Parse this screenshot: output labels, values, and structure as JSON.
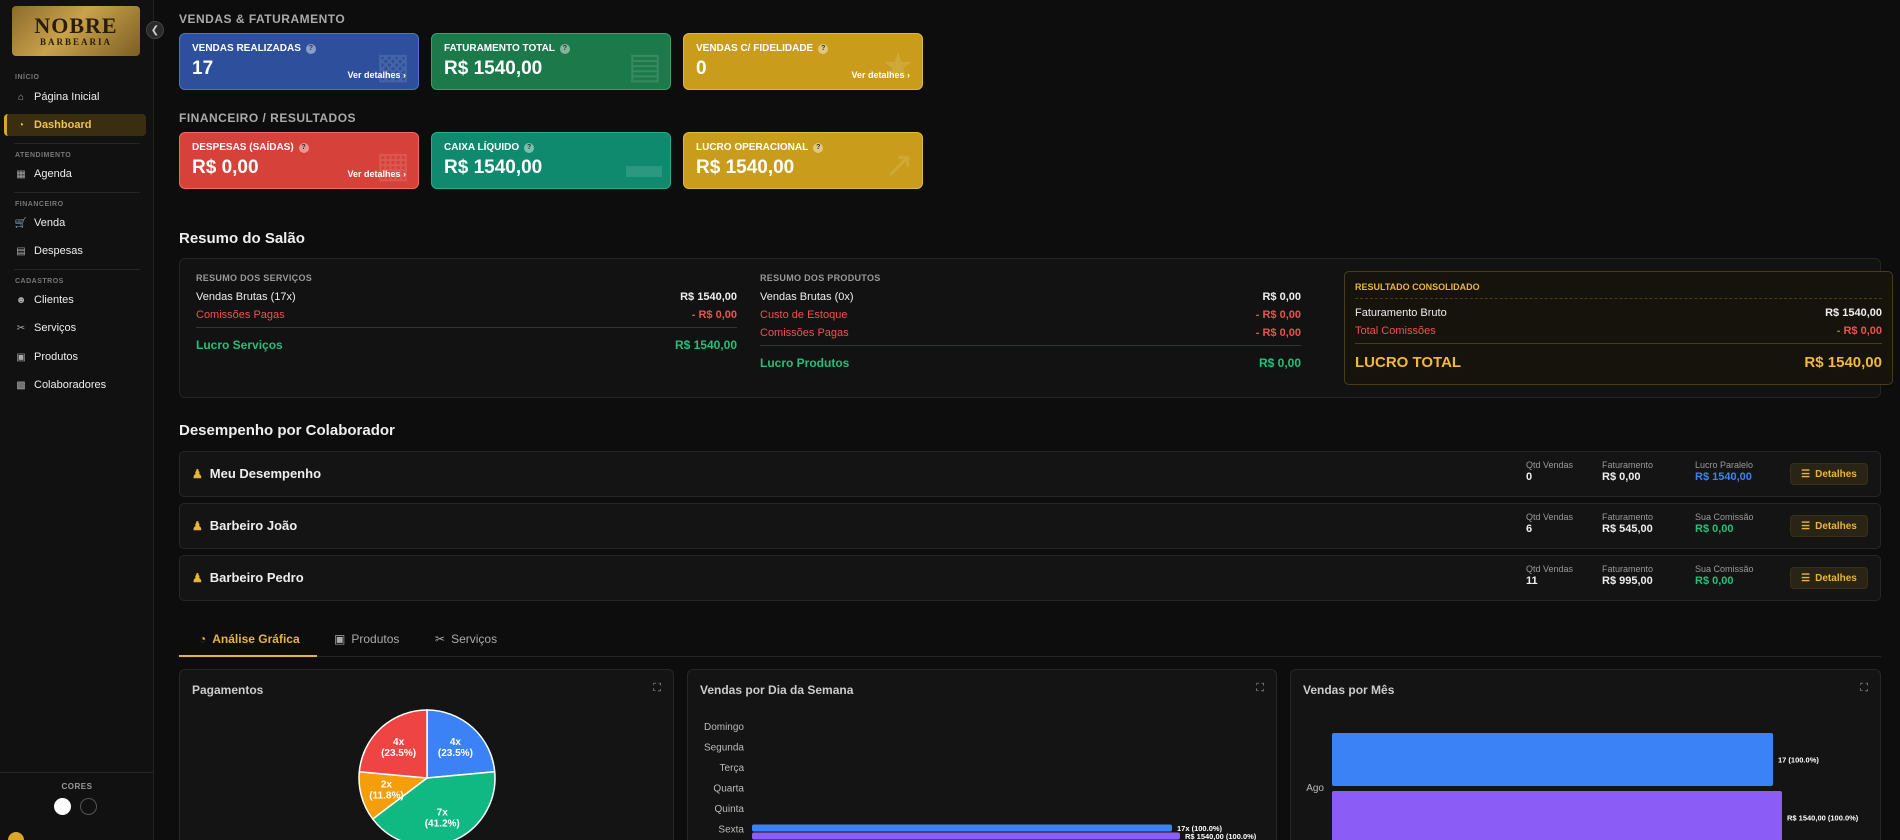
{
  "sidebar": {
    "logo": {
      "line1": "NOBRE",
      "line2": "BARBEARIA"
    },
    "sections": [
      "INÍCIO",
      "ATENDIMENTO",
      "FINANCEIRO",
      "CADASTROS"
    ],
    "items": {
      "home": "Página Inicial",
      "dashboard": "Dashboard",
      "agenda": "Agenda",
      "venda": "Venda",
      "despesas": "Despesas",
      "clientes": "Clientes",
      "servicos": "Serviços",
      "produtos": "Produtos",
      "colaboradores": "Colaboradores"
    },
    "cores_label": "CORES",
    "accent": "#d9a629"
  },
  "vendas": {
    "title": "VENDAS & FATURAMENTO",
    "cards": [
      {
        "label": "VENDAS REALIZADAS",
        "value": "17",
        "more": "Ver detalhes",
        "color": "#2d4f9c"
      },
      {
        "label": "FATURAMENTO TOTAL",
        "value": "R$ 1540,00",
        "color": "#1c7a4a"
      },
      {
        "label": "VENDAS C/ FIDELIDADE",
        "value": "0",
        "more": "Ver detalhes",
        "color": "#c99c1c"
      }
    ]
  },
  "financeiro": {
    "title": "FINANCEIRO / RESULTADOS",
    "cards": [
      {
        "label": "DESPESAS (SAÍDAS)",
        "value": "R$ 0,00",
        "more": "Ver detalhes",
        "color": "#d6413a"
      },
      {
        "label": "CAIXA LÍQUIDO",
        "value": "R$ 1540,00",
        "color": "#0f8a6e"
      },
      {
        "label": "LUCRO OPERACIONAL",
        "value": "R$ 1540,00",
        "color": "#c99c1c"
      }
    ]
  },
  "resumo": {
    "title": "Resumo do Salão",
    "servicos": {
      "head": "RESUMO DOS SERVIÇOS",
      "brutas_label": "Vendas Brutas (17x)",
      "brutas_value": "R$ 1540,00",
      "comissoes_label": "Comissões Pagas",
      "comissoes_value": "- R$ 0,00",
      "lucro_label": "Lucro Serviços",
      "lucro_value": "R$ 1540,00"
    },
    "produtos": {
      "head": "RESUMO DOS PRODUTOS",
      "brutas_label": "Vendas Brutas (0x)",
      "brutas_value": "R$ 0,00",
      "custo_label": "Custo de Estoque",
      "custo_value": "- R$ 0,00",
      "comissoes_label": "Comissões Pagas",
      "comissoes_value": "- R$ 0,00",
      "lucro_label": "Lucro Produtos",
      "lucro_value": "R$ 0,00"
    },
    "consolidado": {
      "head": "RESULTADO CONSOLIDADO",
      "bruto_label": "Faturamento Bruto",
      "bruto_value": "R$ 1540,00",
      "comissoes_label": "Total Comissões",
      "comissoes_value": "- R$ 0,00",
      "total_label": "LUCRO TOTAL",
      "total_value": "R$ 1540,00"
    }
  },
  "desempenho": {
    "title": "Desempenho por Colaborador",
    "details_label": "Detalhes",
    "rows": [
      {
        "name": "Meu Desempenho",
        "qtd_label": "Qtd Vendas",
        "qtd": "0",
        "fat_label": "Faturamento",
        "fat": "R$ 0,00",
        "extra_label": "Lucro Paralelo",
        "extra": "R$ 1540,00"
      },
      {
        "name": "Barbeiro João",
        "qtd_label": "Qtd Vendas",
        "qtd": "6",
        "fat_label": "Faturamento",
        "fat": "R$ 545,00",
        "extra_label": "Sua Comissão",
        "extra": "R$ 0,00"
      },
      {
        "name": "Barbeiro Pedro",
        "qtd_label": "Qtd Vendas",
        "qtd": "11",
        "fat_label": "Faturamento",
        "fat": "R$ 995,00",
        "extra_label": "Sua Comissão",
        "extra": "R$ 0,00"
      }
    ]
  },
  "tabs": [
    "Análise Gráfica",
    "Produtos",
    "Serviços"
  ],
  "chart_data": [
    {
      "type": "pie",
      "title": "Pagamentos",
      "slices": [
        {
          "label": "4x\n(23.5%)",
          "value": 4,
          "percent": 23.5,
          "color": "#3b82f6"
        },
        {
          "label": "7x\n(41.2%)",
          "value": 7,
          "percent": 41.2,
          "color": "#10b981"
        },
        {
          "label": "2x\n(11.8%)",
          "value": 2,
          "percent": 11.8,
          "color": "#f59e0b"
        },
        {
          "label": "4x\n(23.5%)",
          "value": 4,
          "percent": 23.5,
          "color": "#ef4444"
        }
      ]
    },
    {
      "type": "bar",
      "title": "Vendas por Dia da Semana",
      "orientation": "horizontal",
      "categories": [
        "Domingo",
        "Segunda",
        "Terça",
        "Quarta",
        "Quinta",
        "Sexta"
      ],
      "series": [
        {
          "values": [
            0,
            0,
            0,
            0,
            0,
            17
          ],
          "labels": [
            "",
            "",
            "",
            "",
            "",
            "17x (100.0%)"
          ],
          "color": "#3b82f6"
        },
        {
          "values": [
            0,
            0,
            0,
            0,
            0,
            1540
          ],
          "labels": [
            "",
            "",
            "",
            "",
            "",
            "R$ 1540,00 (100.0%)"
          ],
          "color": "#8b5cf6"
        }
      ]
    },
    {
      "type": "bar",
      "title": "Vendas por Mês",
      "orientation": "horizontal",
      "categories": [
        "Ago"
      ],
      "series": [
        {
          "values": [
            17
          ],
          "labels": [
            "17 (100.0%)"
          ],
          "color": "#3b82f6"
        },
        {
          "values": [
            1540
          ],
          "labels": [
            "R$ 1540,00 (100.0%)"
          ],
          "color": "#8b5cf6"
        }
      ]
    }
  ]
}
